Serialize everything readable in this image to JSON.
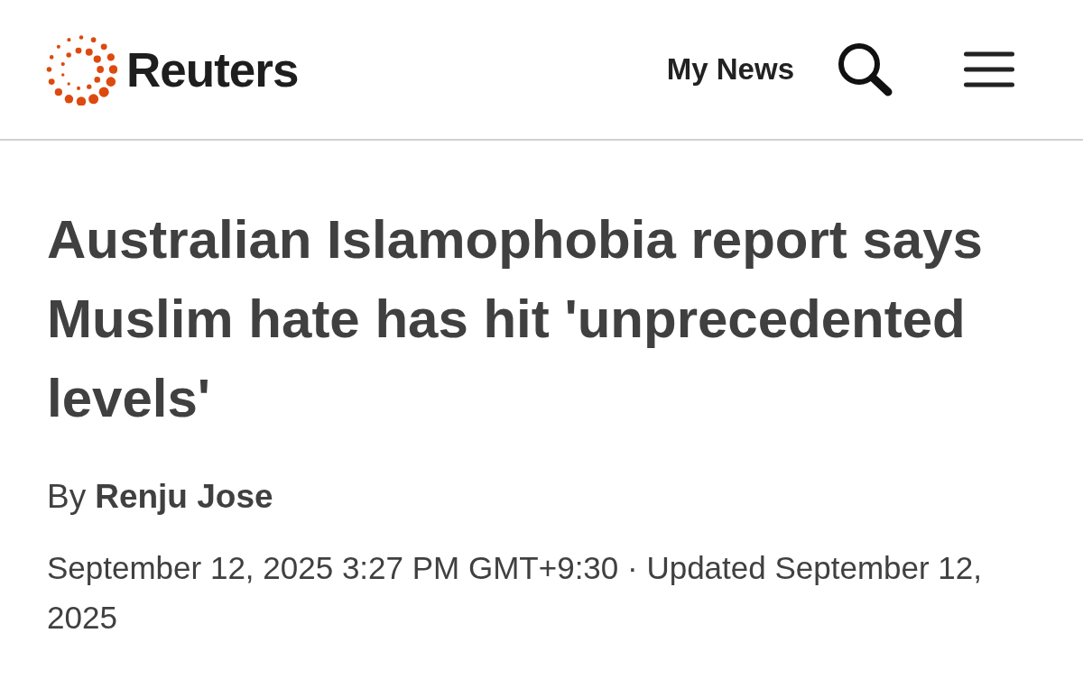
{
  "header": {
    "brand": "Reuters",
    "my_news": "My News"
  },
  "article": {
    "headline": "Australian Islamophobia report says Muslim hate has hit 'unprecedented levels'",
    "byline": {
      "prefix": "By",
      "author": "Renju Jose"
    },
    "dateline": "September 12, 2025 3:27 PM GMT+9:30 · Updated September 12, 2025"
  }
}
